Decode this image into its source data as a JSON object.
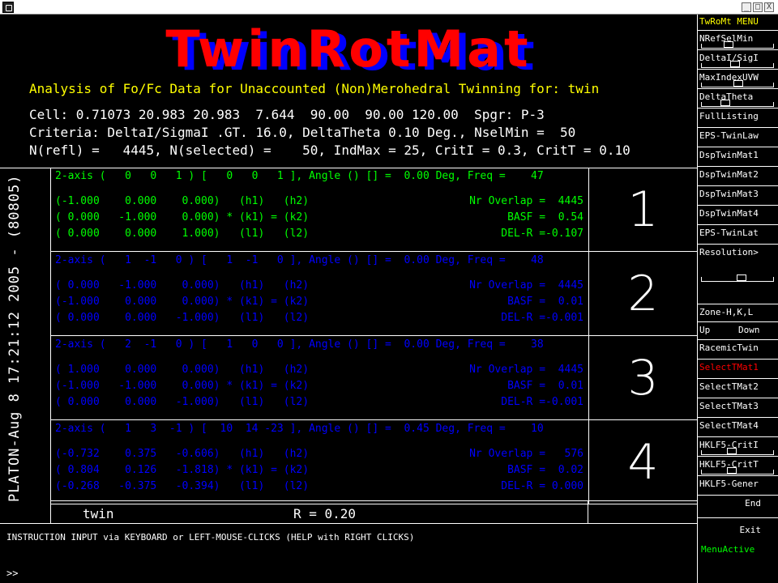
{
  "window": {
    "controls": [
      "_",
      "□",
      "X"
    ]
  },
  "logo": "TwinRotMat",
  "header": {
    "subtitle": "Analysis of Fo/Fc Data for Unaccounted (Non)Merohedral Twinning for: twin",
    "cell": "Cell: 0.71073 20.983 20.983  7.644  90.00  90.00 120.00  Spgr: P-3",
    "criteria": "Criteria: DeltaI/SigmaI .GT. 16.0, DeltaTheta 0.10 Deg., NselMin =  50",
    "nrefl": "N(refl) =   4445, N(selected) =    50, IndMax = 25, CritI = 0.3, CritT = 0.10"
  },
  "vertical_label": "PLATON-Aug  8 17:21:12 2005 - (80805)",
  "twins": [
    {
      "number": "1",
      "color": "#00ff00",
      "axis": "2-axis (   0   0   1 ) [   0   0   1 ], Angle () [] =  0.00 Deg, Freq =    47",
      "rows": [
        "(-1.000    0.000    0.000)   (h1)   (h2)",
        "( 0.000   -1.000    0.000) * (k1) = (k2)",
        "( 0.000    0.000    1.000)   (l1)   (l2)"
      ],
      "labels": [
        "Nr Overlap =  4445",
        "BASF =  0.54",
        "DEL-R =-0.107"
      ]
    },
    {
      "number": "2",
      "color": "#0000ff",
      "axis": "2-axis (   1  -1   0 ) [   1  -1   0 ], Angle () [] =  0.00 Deg, Freq =    48",
      "rows": [
        "( 0.000   -1.000    0.000)   (h1)   (h2)",
        "(-1.000    0.000    0.000) * (k1) = (k2)",
        "( 0.000    0.000   -1.000)   (l1)   (l2)"
      ],
      "labels": [
        "Nr Overlap =  4445",
        "BASF =  0.01",
        "DEL-R =-0.001"
      ]
    },
    {
      "number": "3",
      "color": "#0000ff",
      "axis": "2-axis (   2  -1   0 ) [   1   0   0 ], Angle () [] =  0.00 Deg, Freq =    38",
      "rows": [
        "( 1.000    0.000    0.000)   (h1)   (h2)",
        "(-1.000   -1.000    0.000) * (k1) = (k2)",
        "( 0.000    0.000   -1.000)   (l1)   (l2)"
      ],
      "labels": [
        "Nr Overlap =  4445",
        "BASF =  0.01",
        "DEL-R =-0.001"
      ]
    },
    {
      "number": "4",
      "color": "#0000ff",
      "axis": "2-axis (   1   3  -1 ) [  10  14 -23 ], Angle () [] =  0.45 Deg, Freq =    10",
      "rows": [
        "(-0.732    0.375   -0.606)   (h1)   (h2)",
        "( 0.804    0.126   -1.818) * (k1) = (k2)",
        "(-0.268   -0.375   -0.394)   (l1)   (l2)"
      ],
      "labels": [
        "Nr Overlap =   576",
        "BASF =  0.02",
        "DEL-R = 0.000"
      ]
    }
  ],
  "footer": {
    "name": "twin",
    "r": "R = 0.20"
  },
  "instruction": "INSTRUCTION INPUT via KEYBOARD or LEFT-MOUSE-CLICKS (HELP with RIGHT CLICKS)",
  "prompt": ">>",
  "menu": {
    "title": "TwRoMt MENU",
    "title_color": "#ffff00",
    "items": [
      {
        "label": "NRefSelMin",
        "slider": 0.35
      },
      {
        "label": "DeltaI/SigI",
        "slider": 0.45
      },
      {
        "label": "MaxIndexUVW",
        "slider": 0.5
      },
      {
        "label": "DeltaTheta",
        "slider": 0.3
      },
      {
        "label": "FullListing"
      },
      {
        "label": "EPS-TwinLaw"
      },
      {
        "label": "DspTwinMat1"
      },
      {
        "label": "DspTwinMat2"
      },
      {
        "label": "DspTwinMat3"
      },
      {
        "label": "DspTwinMat4"
      },
      {
        "label": "EPS-TwinLat"
      },
      {
        "label": "Resolution>",
        "slider": 0.55
      },
      {
        "label": "Zone-H,K,L"
      },
      {
        "label": "Up",
        "label2": "Down"
      },
      {
        "label": "RacemicTwin"
      },
      {
        "label": "SelectTMat1",
        "color": "#ff0000"
      },
      {
        "label": "SelectTMat2"
      },
      {
        "label": "SelectTMat3"
      },
      {
        "label": "SelectTMat4"
      },
      {
        "label": "HKLF5-CritI",
        "slider": 0.4
      },
      {
        "label": "HKLF5-CritT",
        "slider": 0.4
      },
      {
        "label": "HKLF5-Gener"
      },
      {
        "label": "End"
      },
      {
        "label": "Exit"
      }
    ],
    "status": "MenuActive",
    "status_color": "#00ff00"
  }
}
